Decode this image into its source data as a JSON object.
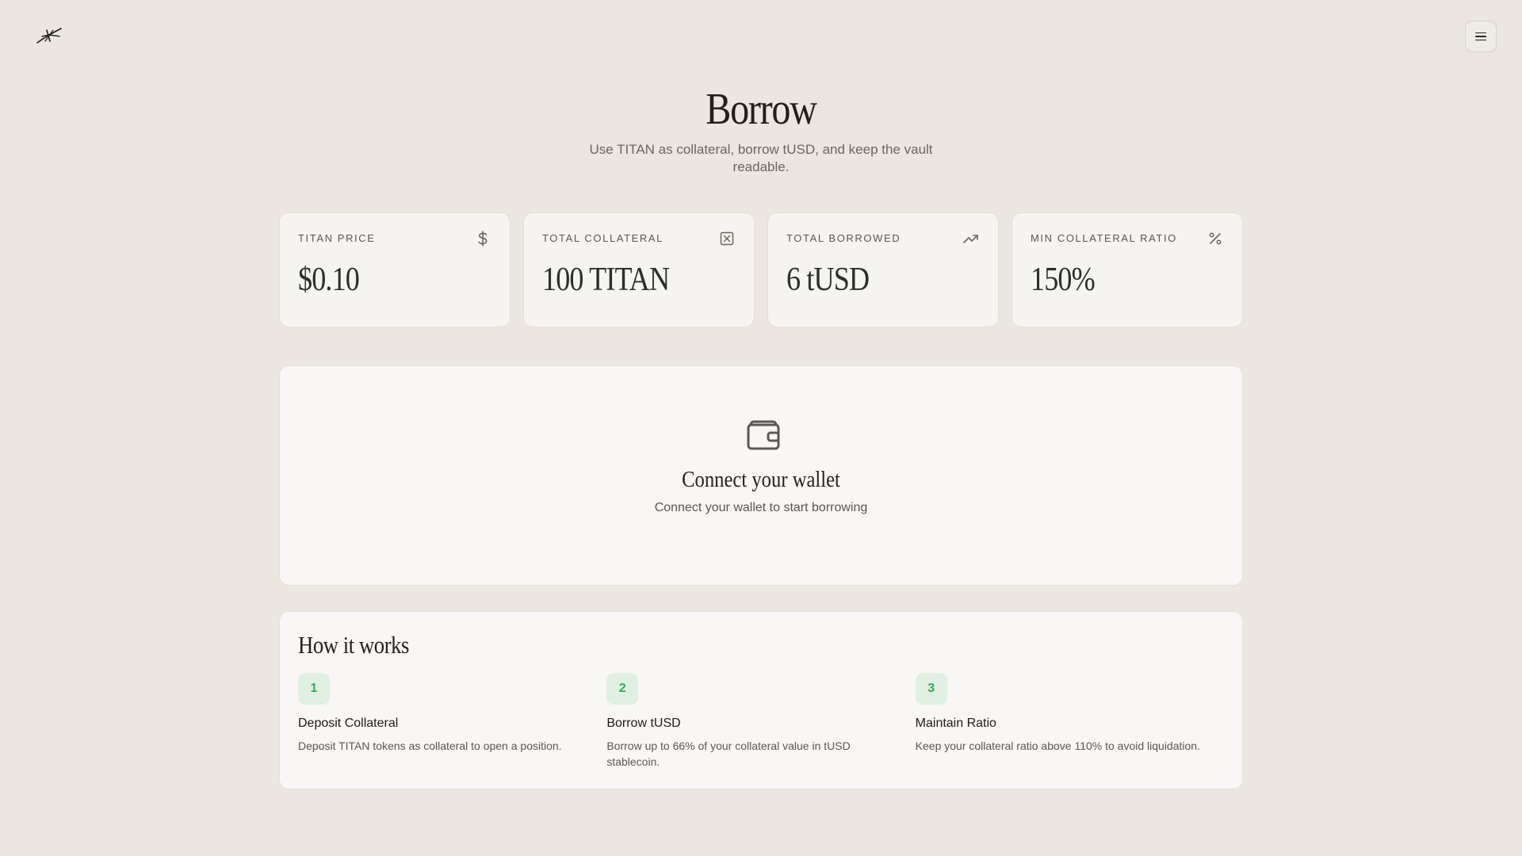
{
  "header": {
    "logo_icon": "crossed-spark-logo",
    "menu_icon": "hamburger-menu-icon"
  },
  "hero": {
    "title": "Borrow",
    "subtitle": "Use TITAN as collateral, borrow tUSD, and keep the vault readable."
  },
  "stats": [
    {
      "label": "TITAN PRICE",
      "value": "$0.10",
      "icon": "dollar-icon"
    },
    {
      "label": "TOTAL COLLATERAL",
      "value": "100 TITAN",
      "icon": "x-box-icon"
    },
    {
      "label": "TOTAL BORROWED",
      "value": "6 tUSD",
      "icon": "trending-up-icon"
    },
    {
      "label": "MIN COLLATERAL RATIO",
      "value": "150%",
      "icon": "percent-icon"
    }
  ],
  "connect": {
    "icon": "wallet-icon",
    "title": "Connect your wallet",
    "subtitle": "Connect your wallet to start borrowing"
  },
  "how": {
    "title": "How it works",
    "steps": [
      {
        "number": "1",
        "title": "Deposit Collateral",
        "description": "Deposit TITAN tokens as collateral to open a position."
      },
      {
        "number": "2",
        "title": "Borrow tUSD",
        "description": "Borrow up to 66% of your collateral value in tUSD stablecoin."
      },
      {
        "number": "3",
        "title": "Maintain Ratio",
        "description": "Keep your collateral ratio above 110% to avoid liquidation."
      }
    ]
  },
  "colors": {
    "background": "#ebe6df",
    "card": "#f6f4f0",
    "accent_green": "#33a85a",
    "accent_green_bg": "#dff0e2"
  }
}
